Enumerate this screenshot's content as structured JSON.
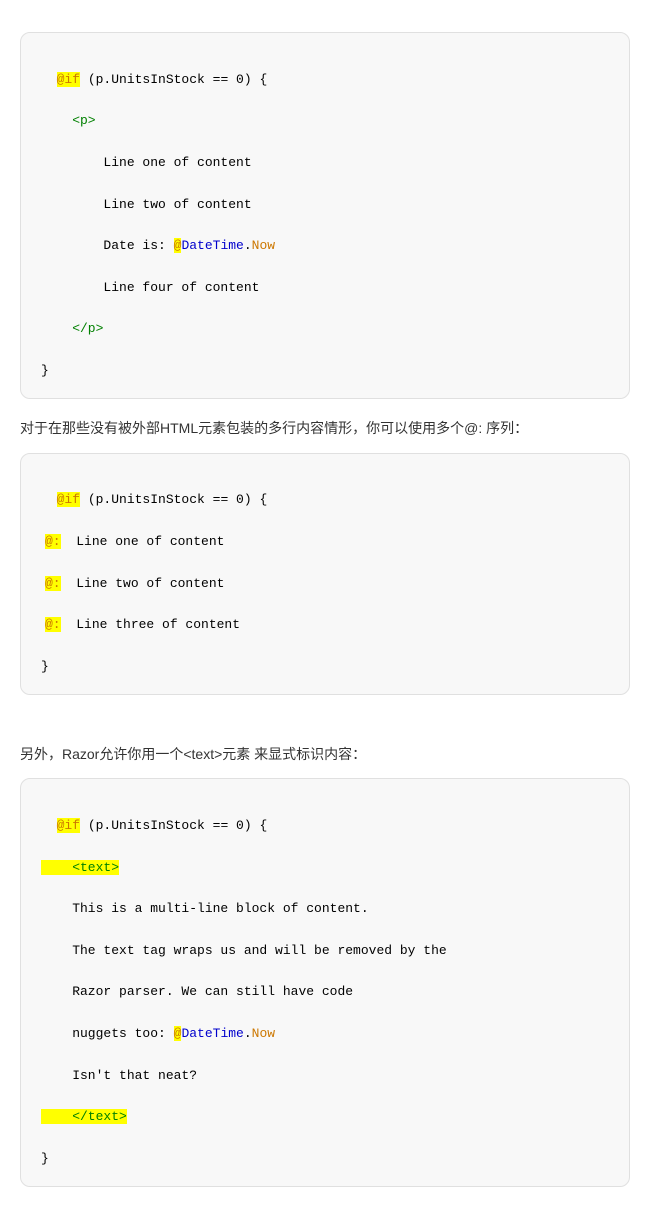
{
  "code_block_1": {
    "lines": [
      {
        "type": "if_line",
        "text": "@if (p.UnitsInStock == 0) {"
      },
      {
        "type": "tag_open",
        "text": "    <p>"
      },
      {
        "type": "content",
        "text": "        Line one of content"
      },
      {
        "type": "content",
        "text": "        Line two of content"
      },
      {
        "type": "datetime_line",
        "text": "        Date is: @DateTime.Now"
      },
      {
        "type": "content",
        "text": "        Line four of content"
      },
      {
        "type": "tag_close",
        "text": "    </p>"
      },
      {
        "type": "brace_close",
        "text": "}"
      }
    ]
  },
  "description_1": "对于在那些没有被外部HTML元素包装的多行内容情形，你可以使用多个@: 序列：",
  "code_block_2": {
    "lines": [
      {
        "type": "if_line",
        "text": "@if (p.UnitsInStock == 0) {"
      },
      {
        "type": "at_colon",
        "text": "    @:  Line one of content"
      },
      {
        "type": "at_colon",
        "text": "    @:  Line two of content"
      },
      {
        "type": "at_colon",
        "text": "    @:  Line three of content"
      },
      {
        "type": "brace_close",
        "text": "}"
      }
    ]
  },
  "description_2": "另外，Razor允许你用一个<text>元素 来显式标识内容：",
  "code_block_3": {
    "lines": [
      {
        "type": "if_line",
        "text": "@if (p.UnitsInStock == 0) {"
      },
      {
        "type": "text_open",
        "text": "    <text>"
      },
      {
        "type": "content",
        "text": "    This is a multi-line block of content."
      },
      {
        "type": "content",
        "text": "    The text tag wraps us and will be removed by the"
      },
      {
        "type": "content",
        "text": "    Razor parser. We can still have code"
      },
      {
        "type": "datetime_line2",
        "text": "    nuggets too: @DateTime.Now"
      },
      {
        "type": "content",
        "text": "    Isn't that neat?"
      },
      {
        "type": "text_close",
        "text": "    </text>"
      },
      {
        "type": "brace_close",
        "text": "}"
      }
    ]
  }
}
